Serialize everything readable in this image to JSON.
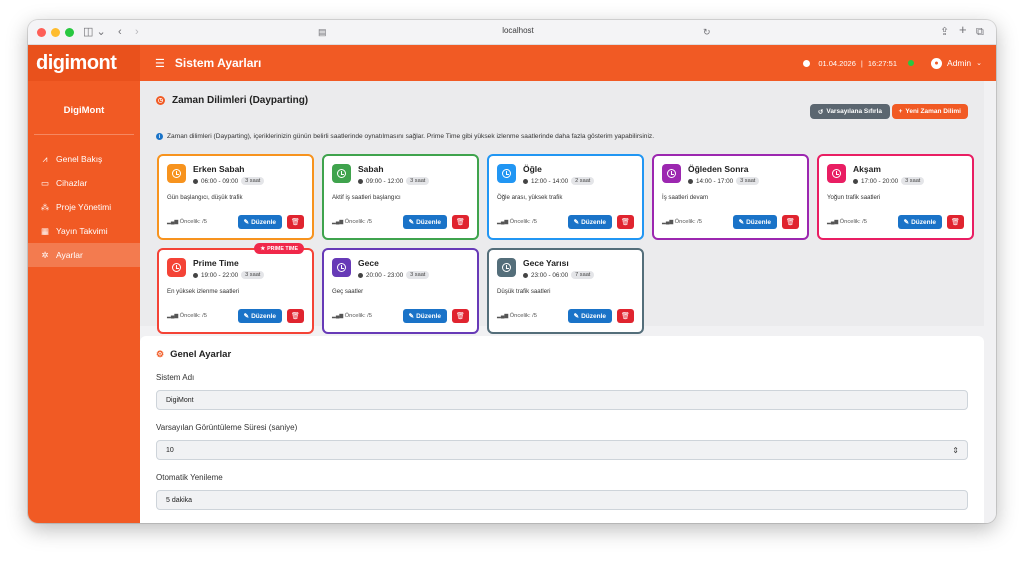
{
  "browser": {
    "url": "localhost"
  },
  "app": {
    "logo": "digimont",
    "brand": "DigiMont"
  },
  "sidebar": {
    "items": [
      {
        "label": "Genel Bakış",
        "icon": "chart-line-icon",
        "glyph": "⩘"
      },
      {
        "label": "Cihazlar",
        "icon": "monitor-icon",
        "glyph": "▭"
      },
      {
        "label": "Proje Yönetimi",
        "icon": "sitemap-icon",
        "glyph": "⁂"
      },
      {
        "label": "Yayın Takvimi",
        "icon": "calendar-icon",
        "glyph": "▦"
      },
      {
        "label": "Ayarlar",
        "icon": "gear-icon",
        "glyph": "✲"
      }
    ]
  },
  "topbar": {
    "title": "Sistem Ayarları",
    "date": "01.04.2026",
    "separator": "|",
    "time": "16:27:51",
    "user": "Admin"
  },
  "dayparting": {
    "title": "Zaman Dilimleri (Dayparting)",
    "reset_label": "Varsayılana Sıfırla",
    "new_label": "Yeni Zaman Dilimi",
    "info": "Zaman dilimleri (Dayparting), içeriklerinizin günün belirli saatlerinde oynatılmasını sağlar. Prime Time gibi yüksek izlenme saatlerinde daha fazla gösterim yapabilirsiniz.",
    "edit_label": "Düzenle",
    "prime_label": "PRIME TIME",
    "slots": [
      {
        "name": "Erken Sabah",
        "time": "06:00 - 09:00",
        "duration": "3 saat",
        "desc": "Gün başlangıcı, düşük trafik",
        "priority": "Öncelik: /5",
        "color": "#f7931e"
      },
      {
        "name": "Sabah",
        "time": "09:00 - 12:00",
        "duration": "3 saat",
        "desc": "Aktif iş saatleri başlangıcı",
        "priority": "Öncelik: /5",
        "color": "#3fa34d"
      },
      {
        "name": "Öğle",
        "time": "12:00 - 14:00",
        "duration": "2 saat",
        "desc": "Öğle arası, yüksek trafik",
        "priority": "Öncelik: /5",
        "color": "#2196f3"
      },
      {
        "name": "Öğleden Sonra",
        "time": "14:00 - 17:00",
        "duration": "3 saat",
        "desc": "İş saatleri devam",
        "priority": "Öncelik: /5",
        "color": "#9c27b0"
      },
      {
        "name": "Akşam",
        "time": "17:00 - 20:00",
        "duration": "3 saat",
        "desc": "Yoğun trafik saatleri",
        "priority": "Öncelik: /5",
        "color": "#e91e63"
      },
      {
        "name": "Prime Time",
        "time": "19:00 - 22:00",
        "duration": "3 saat",
        "desc": "En yüksek izlenme saatleri",
        "priority": "Öncelik: /5",
        "color": "#f44336",
        "prime": true
      },
      {
        "name": "Gece",
        "time": "20:00 - 23:00",
        "duration": "3 saat",
        "desc": "Geç saatler",
        "priority": "Öncelik: /5",
        "color": "#673ab7"
      },
      {
        "name": "Gece Yarısı",
        "time": "23:00 - 06:00",
        "duration": "7 saat",
        "desc": "Düşük trafik saatleri",
        "priority": "Öncelik: /5",
        "color": "#546e7a"
      }
    ]
  },
  "general": {
    "title": "Genel Ayarlar",
    "system_name_label": "Sistem Adı",
    "system_name_value": "DigiMont",
    "display_duration_label": "Varsayılan Görüntüleme Süresi (saniye)",
    "display_duration_value": "10",
    "auto_refresh_label": "Otomatik Yenileme",
    "auto_refresh_value": "5 dakika"
  }
}
